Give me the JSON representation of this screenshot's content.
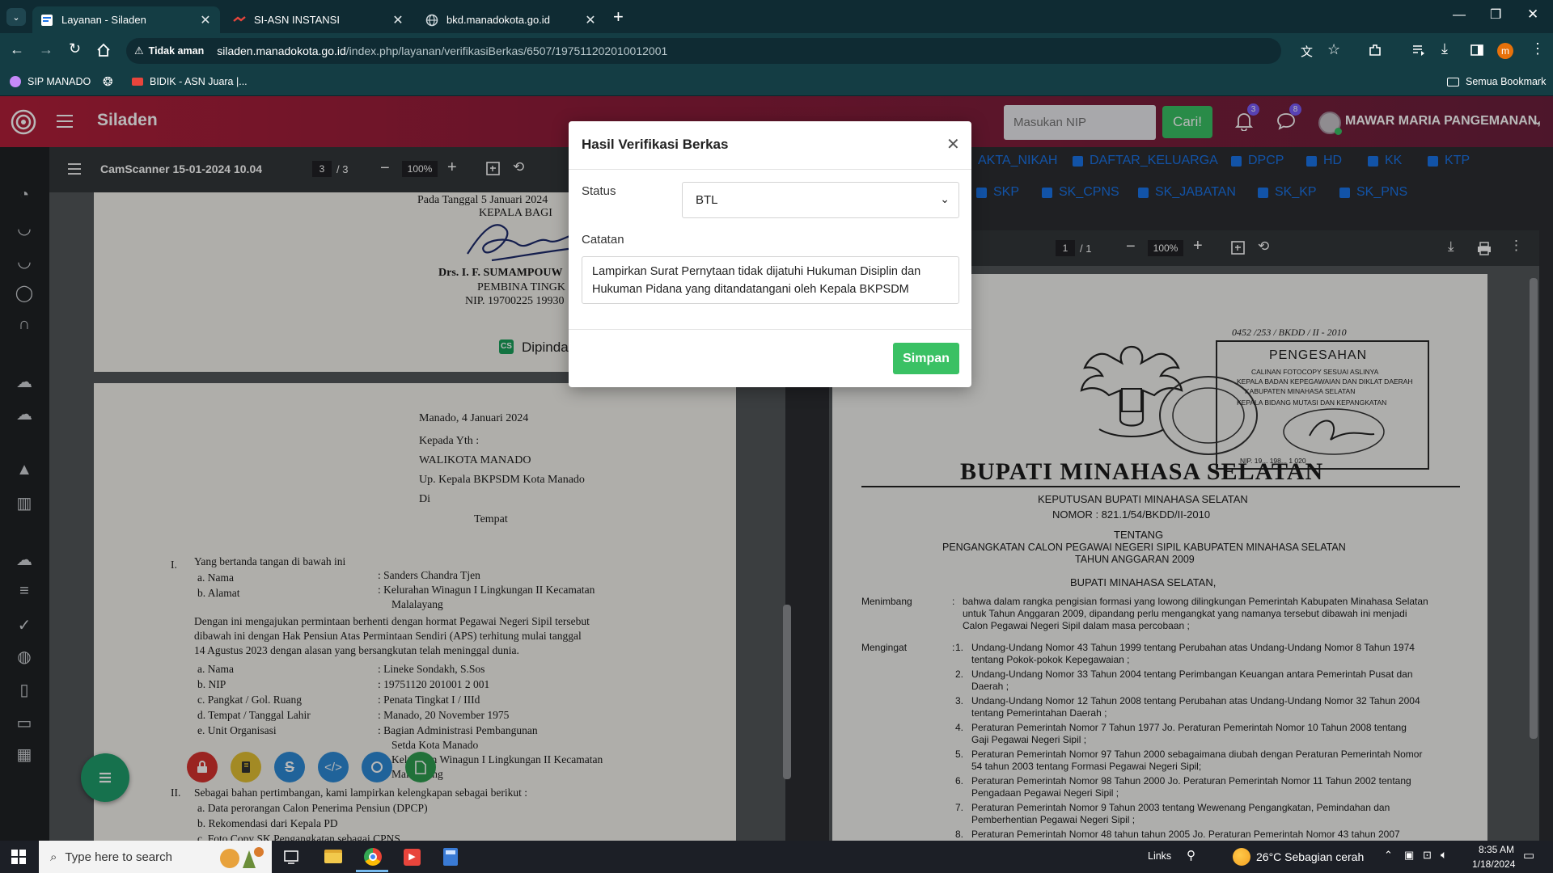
{
  "browser": {
    "tabs": [
      {
        "title": "Layanan - Siladen",
        "active": true
      },
      {
        "title": "SI-ASN INSTANSI",
        "active": false
      },
      {
        "title": "bkd.manadokota.go.id",
        "active": false
      }
    ],
    "security_label": "Tidak aman",
    "url_host": "siladen.manadokota.go.id",
    "url_path": "/index.php/layanan/verifikasiBerkas/6507/197511202010012001",
    "bookmarks": [
      "SIP MANADO",
      "BIDIK - ASN Juara |..."
    ],
    "all_bookmarks": "Semua Bookmark",
    "profile_initial": "m"
  },
  "app": {
    "name": "Siladen",
    "search_placeholder": "Masukan NIP",
    "search_button": "Cari!",
    "notif_count": "3",
    "msg_count": "8",
    "user_name": "MAWAR MARIA PANGEMANAN,",
    "sidebar_icons": [
      "dashboard-icon",
      "user-icon",
      "user-icon",
      "whatsapp-icon",
      "headset-icon",
      "cloud-upload-icon",
      "cloud-download-icon",
      "graduation-icon",
      "bank-icon",
      "cloud-download-icon",
      "list-icon",
      "check-circle-icon",
      "globe-icon",
      "document-user-icon",
      "monitor-icon",
      "grid-icon"
    ]
  },
  "left_pdf": {
    "filename": "CamScanner 15-01-2024 10.04",
    "page": "3",
    "pages": "/ 3",
    "zoom": "100%",
    "page2_top": {
      "date_line": "Pada Tanggal  5  Januari 2024",
      "title_line": "KEPALA BAGI",
      "name": "Drs. I. F. SUMAMPOUW",
      "rank": "PEMBINA TINGK",
      "nip": "NIP. 19700225 19930",
      "scanner": "Dipinda"
    },
    "letter": {
      "date": "Manado,  4  Januari 2024",
      "to1": "Kepada Yth :",
      "to2": "WALIKOTA MANADO",
      "to3": "Up. Kepala BKPSDM Kota Manado",
      "to4": "Di",
      "to5": "Tempat",
      "s1_num": "I.",
      "s1": "Yang bertanda tangan di bawah ini",
      "a_label": "a.   Nama",
      "a_val": ":   Sanders Chandra Tjen",
      "b_label": "b.   Alamat",
      "b_val": ":   Kelurahan Winagun I Lingkungan II Kecamatan",
      "b_val2": "Malalayang",
      "para1": "Dengan ini mengajukan permintaan berhenti dengan hormat Pegawai Negeri Sipil tersebut",
      "para2": "dibawah ini dengan Hak Pensiun Atas Permintaan Sendiri (APS) terhitung mulai tanggal",
      "para3": "14 Agustus 2023 dengan alasan yang bersangkutan telah meninggal dunia.",
      "rows": [
        {
          "l": "a.   Nama",
          "v": ":   Lineke Sondakh, S.Sos"
        },
        {
          "l": "b.   NIP",
          "v": ":   19751120 201001 2 001"
        },
        {
          "l": "c.   Pangkat / Gol. Ruang",
          "v": ":   Penata Tingkat I / IIId"
        },
        {
          "l": "d.   Tempat / Tanggal Lahir",
          "v": ":   Manado, 20 November 1975"
        },
        {
          "l": "e.   Unit Organisasi",
          "v": ":   Bagian Administrasi Pembangunan"
        }
      ],
      "e_val2": "Setda Kota Manado",
      "f_val": "Kelurahan Winagun I Lingkungan II Kecamatan",
      "f_val2": "Malalayang",
      "s2_num": "II.",
      "s2": "Sebagai bahan pertimbangan, kami lampirkan kelengkapan sebagai berikut :",
      "att_a": "a.   Data perorangan Calon Penerima Pensiun (DPCP)",
      "att_b": "b.   Rekomendasi dari Kepala PD",
      "att_c": "c.   Foto Copy SK Pengangkatan sebagai CPNS"
    }
  },
  "doc_chips_row1": [
    "AKTA_NIKAH",
    "DAFTAR_KELUARGA",
    "DPCP",
    "HD",
    "KK",
    "KTP"
  ],
  "doc_chips_row2": [
    "SKP",
    "SK_CPNS",
    "SK_JABATAN",
    "SK_KP",
    "SK_PNS"
  ],
  "right_pdf": {
    "page": "1",
    "pages": "/ 1",
    "zoom": "100%",
    "ref_no": "0452 /253 / BKDD / II - 2010",
    "stamp_title": "PENGESAHAN",
    "stamp_l1": "CALINAN FOTOCOPY SESUAI ASLINYA",
    "stamp_l2": "KEPALA BADAN KEPEGAWAIAN DAN DIKLAT DAERAH",
    "stamp_l3": "KABUPATEN MINAHASA SELATAN",
    "stamp_l4": "KEPALA BIDANG MUTASI DAN KEPANGKATAN",
    "stamp_nip": "NIP. 19... 198... 1 020",
    "heading": "BUPATI MINAHASA SELATAN",
    "kep": "KEPUTUSAN BUPATI MINAHASA SELATAN",
    "nomor": "NOMOR : 821.1/54/BKDD/II-2010",
    "tentang": "TENTANG",
    "subject1": "PENGANGKATAN CALON PEGAWAI NEGERI SIPIL KABUPATEN MINAHASA SELATAN",
    "subject2": "TAHUN ANGGARAN 2009",
    "bupati": "BUPATI MINAHASA SELATAN,",
    "menimbang_label": "Menimbang",
    "menimbang": [
      "bahwa dalam rangka pengisian formasi yang lowong dilingkungan Pemerintah Kabupaten Minahasa Selatan",
      "untuk Tahun Anggaran 2009, dipandang perlu mengangkat yang namanya tersebut dibawah ini menjadi",
      "Calon Pegawai Negeri Sipil dalam masa percobaan ;"
    ],
    "mengingat_label": "Mengingat",
    "mengingat": [
      {
        "n": "1.",
        "t1": "Undang-Undang Nomor 43 Tahun 1999 tentang Perubahan atas Undang-Undang Nomor 8 Tahun 1974",
        "t2": "tentang Pokok-pokok Kepegawaian ;"
      },
      {
        "n": "2.",
        "t1": "Undang-Undang Nomor 33 Tahun 2004 tentang Perimbangan Keuangan antara Pemerintah Pusat dan",
        "t2": "Daerah ;"
      },
      {
        "n": "3.",
        "t1": "Undang-Undang Nomor 12 Tahun 2008 tentang Perubahan atas Undang-Undang Nomor 32 Tahun 2004",
        "t2": "tentang Pemerintahan Daerah ;"
      },
      {
        "n": "4.",
        "t1": "Peraturan Pemerintah Nomor 7 Tahun 1977 Jo. Peraturan Pemerintah Nomor 10 Tahun 2008 tentang",
        "t2": "Gaji Pegawai Negeri Sipil ;"
      },
      {
        "n": "5.",
        "t1": "Peraturan Pemerintah Nomor 97 Tahun 2000 sebagaimana diubah dengan Peraturan Pemerintah Nomor",
        "t2": "54 tahun 2003 tentang Formasi Pegawai Negeri Sipil;"
      },
      {
        "n": "6.",
        "t1": "Peraturan Pemerintah Nomor 98 Tahun 2000 Jo. Peraturan Pemerintah Nomor 11 Tahun 2002 tentang",
        "t2": "Pengadaan Pegawai Negeri Sipil ;"
      },
      {
        "n": "7.",
        "t1": "Peraturan Pemerintah Nomor 9 Tahun 2003 tentang Wewenang Pengangkatan, Pemindahan dan",
        "t2": "Pemberhentian Pegawai Negeri Sipil ;"
      },
      {
        "n": "8.",
        "t1": "Peraturan Pemerintah Nomor 48 tahun tahun 2005 Jo. Peraturan Pemerintah Nomor 43 tahun 2007",
        "t2": ""
      }
    ]
  },
  "modal": {
    "title": "Hasil Verifikasi Berkas",
    "status_label": "Status",
    "status_value": "BTL",
    "note_label": "Catatan",
    "note_value": "Lampirkan Surat Pernytaan tidak dijatuhi Hukuman Disiplin dan Hukuman Pidana yang ditandatangani oleh Kepala BKPSDM",
    "save_button": "Simpan"
  },
  "taskbar": {
    "search_placeholder": "Type here to search",
    "links": "Links",
    "weather": "26°C  Sebagian cerah",
    "time": "8:35 AM",
    "date": "1/18/2024"
  }
}
